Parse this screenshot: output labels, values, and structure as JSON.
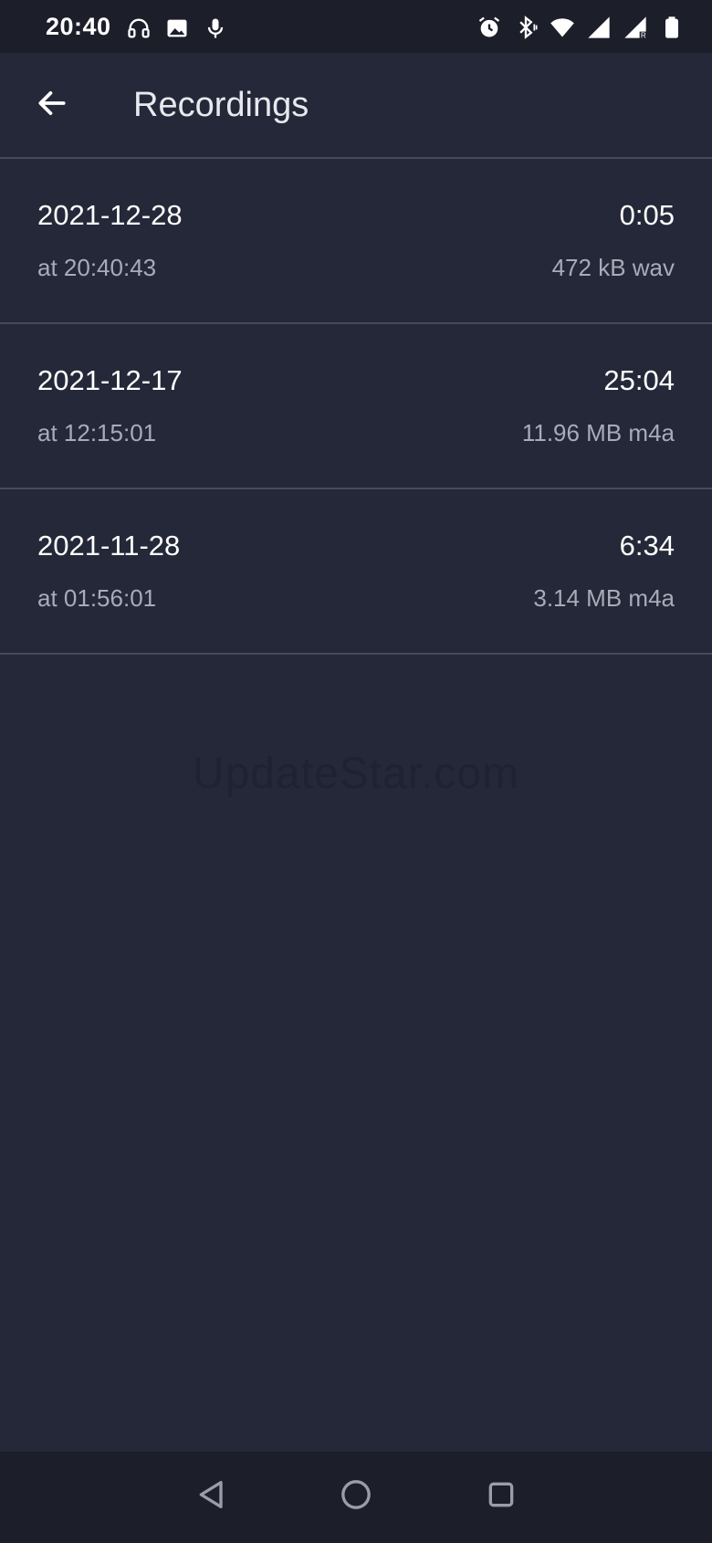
{
  "status_bar": {
    "time": "20:40",
    "left_icons": [
      "headphones-icon",
      "image-icon",
      "microphone-icon"
    ],
    "right_icons": [
      "alarm-icon",
      "bluetooth-vibrate-icon",
      "wifi-icon",
      "signal-icon",
      "signal-roaming-icon",
      "battery-icon"
    ]
  },
  "app_bar": {
    "title": "Recordings",
    "back_icon": "arrow-back-icon"
  },
  "recordings": [
    {
      "date": "2021-12-28",
      "time": "at 20:40:43",
      "duration": "0:05",
      "size": "472 kB wav"
    },
    {
      "date": "2021-12-17",
      "time": "at 12:15:01",
      "duration": "25:04",
      "size": "11.96 MB m4a"
    },
    {
      "date": "2021-11-28",
      "time": "at 01:56:01",
      "duration": "6:34",
      "size": "3.14 MB m4a"
    }
  ],
  "watermark": "UpdateStar.com",
  "nav_bar": {
    "icons": [
      "nav-back-icon",
      "nav-home-icon",
      "nav-recents-icon"
    ]
  },
  "colors": {
    "background": "#252838",
    "bars": "#1c1e2a",
    "divider": "#464a5c",
    "primary_text": "#ffffff",
    "secondary_text": "#a9abb8"
  }
}
